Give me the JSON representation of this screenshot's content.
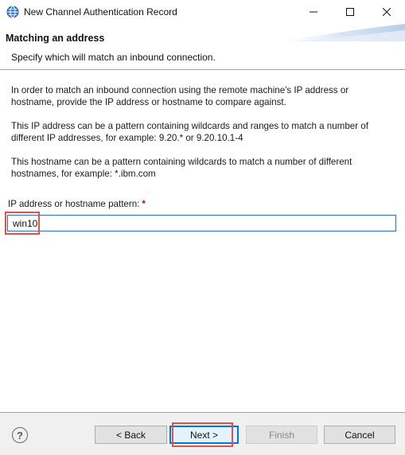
{
  "window": {
    "title": "New Channel Authentication Record",
    "app_icon": "globe-icon",
    "controls": [
      "minimize-icon",
      "maximize-icon",
      "close-icon"
    ]
  },
  "banner": {
    "title": "Matching an address",
    "description": "Specify which will match an inbound connection."
  },
  "content": {
    "paragraphs": [
      "In order to match an inbound connection using the remote machine's IP address or hostname, provide the IP address or hostname to compare against.",
      "This IP address can be a pattern containing wildcards and ranges to match a number of different IP addresses, for example: 9.20.* or 9.20.10.1-4",
      "This hostname can be a pattern containing wildcards to match a number of different hostnames, for example: *.ibm.com"
    ],
    "field_label": "IP address or hostname pattern:",
    "required_marker": "*",
    "field_value": "win10"
  },
  "footer": {
    "help_icon": "help-icon",
    "back_label": "< Back",
    "next_label": "Next >",
    "finish_label": "Finish",
    "cancel_label": "Cancel"
  },
  "colors": {
    "highlight": "#e0514f",
    "focus": "#0078d7",
    "required": "#d0021b"
  }
}
